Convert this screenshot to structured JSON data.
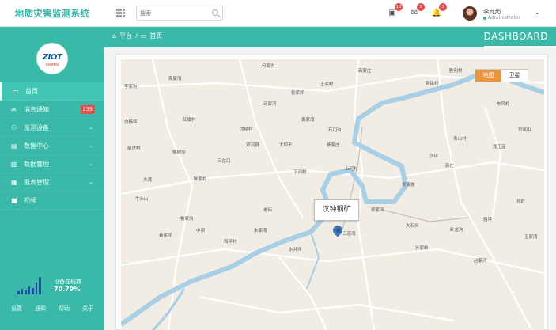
{
  "app": {
    "title": "地质灾害监测系统"
  },
  "search": {
    "placeholder": "搜索"
  },
  "toolbar": {
    "items": [
      {
        "icon": "inbox-icon",
        "badge": "10"
      },
      {
        "icon": "envelope-icon",
        "badge": "5"
      },
      {
        "icon": "bell-icon",
        "badge": "3"
      }
    ]
  },
  "user": {
    "name": "李元历",
    "role": "Administrator",
    "status_color": "#3cb371"
  },
  "logo": {
    "text": "ZIOT",
    "sub": "中科物联网"
  },
  "sidebar": {
    "items": [
      {
        "icon": "laptop-icon",
        "label": "首页",
        "active": true
      },
      {
        "icon": "envelope-icon",
        "label": "消息通知",
        "badge": "235"
      },
      {
        "icon": "users-icon",
        "label": "监测设备",
        "has_children": true
      },
      {
        "icon": "calendar-icon",
        "label": "数据中心",
        "has_children": true
      },
      {
        "icon": "chart-icon",
        "label": "数据管理",
        "has_children": true
      },
      {
        "icon": "table-icon",
        "label": "报表管理",
        "has_children": true
      },
      {
        "icon": "video-icon",
        "label": "视频"
      }
    ],
    "stats": {
      "label": "设备在线数",
      "value": "70.79%"
    },
    "footer_links": [
      "设置",
      "通知",
      "帮助",
      "关于"
    ]
  },
  "breadcrumb": {
    "home": "平台",
    "current": "首页"
  },
  "dashboard": {
    "title": "DASHBOARD"
  },
  "map": {
    "type_buttons": [
      {
        "label": "地图",
        "active": true
      },
      {
        "label": "卫星",
        "active": false
      }
    ],
    "callout": "汉钟钢矿",
    "places": [
      "何家沟",
      "高家庄",
      "胜利村",
      "周家湾",
      "王家岭",
      "李家沟",
      "张家坪",
      "新民村",
      "马家河",
      "东风岭",
      "红旗村",
      "黄家湾",
      "团结村",
      "石门沟",
      "白杨坪",
      "刘家山",
      "前进村",
      "双河镇",
      "大坝子",
      "杨家庄",
      "青山村",
      "龙王庙",
      "柳树沟",
      "三岔口",
      "沙坪",
      "新庄",
      "下河村",
      "上河村",
      "大湾",
      "陈家岭",
      "吴家坡",
      "牛头山",
      "长岭",
      "老街",
      "郑家河",
      "鲁家沟",
      "庙坪",
      "大石头",
      "中坝",
      "朱家湾",
      "卧龙沟",
      "三道湾",
      "秦家坪",
      "王家湾",
      "和平村",
      "孙家岭",
      "水井坪",
      "赵家河"
    ]
  }
}
